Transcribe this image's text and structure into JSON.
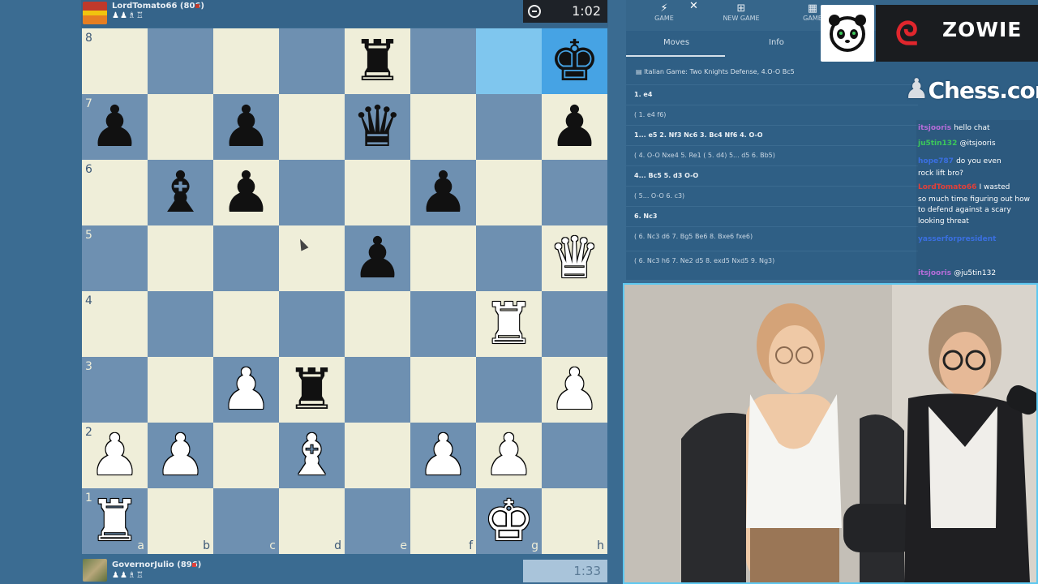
{
  "players": {
    "top": {
      "name": "LordTomato66 (806)",
      "icons": "♟♟♗♖",
      "clock": "1:02"
    },
    "bottom": {
      "name": "GovernorJulio (896)",
      "icons": "♟♟♗♖",
      "clock": "1:33"
    }
  },
  "board": {
    "ranks": [
      "8",
      "7",
      "6",
      "5",
      "4",
      "3",
      "2",
      "1"
    ],
    "files": [
      "a",
      "b",
      "c",
      "d",
      "e",
      "f",
      "g",
      "h"
    ],
    "pieces": {
      "e8": "bR",
      "h8": "bK",
      "a7": "bP",
      "c7": "bP",
      "e7": "bQ",
      "h7": "bP",
      "b6": "bB",
      "c6": "bP",
      "f6": "bP",
      "e5": "bP",
      "h5": "wQ",
      "g4": "wR",
      "c3": "wP",
      "d3": "bR",
      "h3": "wP",
      "a2": "wP",
      "b2": "wP",
      "d2": "wB",
      "f2": "wP",
      "g2": "wP",
      "a1": "wR",
      "g1": "wK"
    },
    "highlighted": [
      "g8",
      "h8"
    ]
  },
  "panel": {
    "tabs": [
      {
        "label": "GAME",
        "icon": "⚡"
      },
      {
        "label": "NEW GAME",
        "icon": "⊞"
      },
      {
        "label": "GAME",
        "icon": "▦"
      }
    ],
    "close": "✕",
    "subtabs": [
      "Moves",
      "Info"
    ],
    "opening": "Italian Game: Two Knights Defense, 4.O-O Bc5",
    "moves": [
      {
        "text": "1. e4",
        "variation": false
      },
      {
        "text": "( 1. e4 f6)",
        "variation": true
      },
      {
        "text": "1... e5 2. Nf3 Nc6 3. Bc4 Nf6 4. O-O",
        "variation": false
      },
      {
        "text": "( 4. O-O Nxe4 5. Re1 ( 5. d4) 5... d5 6. Bb5)",
        "variation": true
      },
      {
        "text": "4... Bc5 5. d3 O-O",
        "variation": false
      },
      {
        "text": "( 5... O-O 6. c3)",
        "variation": true
      },
      {
        "text": "6. Nc3",
        "variation": false
      },
      {
        "text": "( 6. Nc3 d6 7. Bg5 Be6 8. Bxe6 fxe6)",
        "variation": true
      },
      {
        "text": "( 6. Nc3 h6 7. Ne2 d5 8. exd5 Nxd5 9. Ng3)",
        "variation": true
      }
    ]
  },
  "logos": {
    "zowie_mark": "ᘓ",
    "zowie": "ZOWIE",
    "chesscom": "Chess.com",
    "pawn": "♟"
  },
  "chat": [
    {
      "user": "itsjooris",
      "color": "#b56dd9",
      "msg": "hello chat"
    },
    {
      "user": "ju5tin132",
      "color": "#3cc85a",
      "msg": "@itsjooris"
    },
    {
      "user": "hope787",
      "color": "#3a6fe0",
      "msg": "do you even"
    },
    {
      "user": "",
      "color": "#ffffff",
      "msg": "rock lift bro?"
    },
    {
      "user": "LordTomato66",
      "color": "#e0403a",
      "msg": "I wasted"
    },
    {
      "user": "",
      "color": "#ffffff",
      "msg": "so much time figuring out how"
    },
    {
      "user": "",
      "color": "#ffffff",
      "msg": "to defend against a scary"
    },
    {
      "user": "",
      "color": "#ffffff",
      "msg": "looking threat"
    },
    {
      "user": "yasserforpresident",
      "color": "#3a6fe0",
      "msg": ""
    },
    {
      "user": "itsjooris",
      "color": "#b56dd9",
      "msg": "@ju5tin132"
    }
  ],
  "colors": {
    "light": "#efeed9",
    "dark": "#6e90b1",
    "highlight": "#7fc6ee"
  }
}
